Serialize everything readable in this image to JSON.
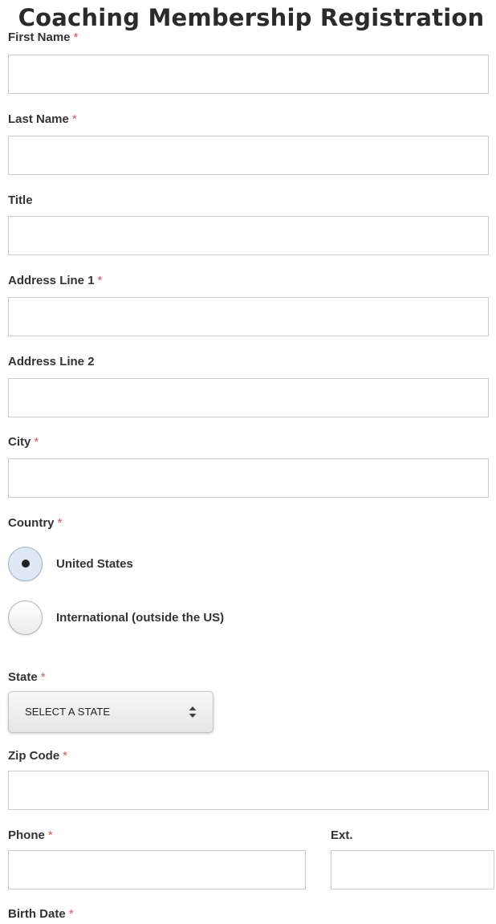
{
  "page": {
    "title": "Coaching Membership Registration"
  },
  "form": {
    "required_marker": "*",
    "first_name": {
      "label": "First Name",
      "required": true,
      "value": ""
    },
    "last_name": {
      "label": "Last Name",
      "required": true,
      "value": ""
    },
    "title": {
      "label": "Title",
      "required": false,
      "value": ""
    },
    "address_line_1": {
      "label": "Address Line 1",
      "required": true,
      "value": ""
    },
    "address_line_2": {
      "label": "Address Line 2",
      "required": false,
      "value": ""
    },
    "city": {
      "label": "City",
      "required": true,
      "value": ""
    },
    "country": {
      "label": "Country",
      "required": true,
      "options": [
        {
          "label": "United States",
          "selected": true
        },
        {
          "label": "International (outside the US)",
          "selected": false
        }
      ]
    },
    "state": {
      "label": "State",
      "required": true,
      "selected": "SELECT A STATE",
      "icon": "up-down-arrows-icon"
    },
    "zip_code": {
      "label": "Zip Code",
      "required": true,
      "value": ""
    },
    "phone": {
      "label": "Phone",
      "required": true,
      "value": ""
    },
    "ext": {
      "label": "Ext.",
      "required": false,
      "value": ""
    },
    "birth_date": {
      "label": "Birth Date",
      "required": true
    }
  },
  "colors": {
    "required": "#d9534f",
    "input_border": "#cccccc",
    "radio_selected": "#dfe9f6"
  }
}
